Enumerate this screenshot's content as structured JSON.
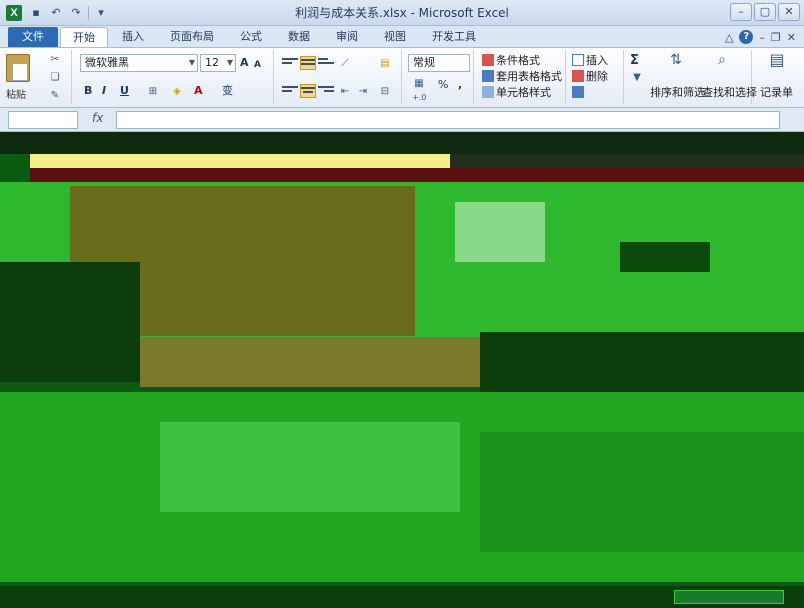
{
  "window": {
    "title": "利润与成本关系.xlsx - Microsoft Excel",
    "app_letter": "X"
  },
  "tabs": [
    {
      "label": "文件"
    },
    {
      "label": "开始"
    },
    {
      "label": "插入"
    },
    {
      "label": "页面布局"
    },
    {
      "label": "公式"
    },
    {
      "label": "数据"
    },
    {
      "label": "审阅"
    },
    {
      "label": "视图"
    },
    {
      "label": "开发工具"
    }
  ],
  "ribbon": {
    "clipboard": {
      "paste_label": "粘贴"
    },
    "font": {
      "name": "微软雅黑",
      "size": "12",
      "bold": "B",
      "italic": "I",
      "underline": "U",
      "grow": "A",
      "shrink": "A",
      "color_letter": "A",
      "phonetic": "变"
    },
    "number": {
      "format": "常规",
      "percent": "%",
      "comma": ","
    },
    "styles": {
      "conditional": "条件格式",
      "table": "套用表格格式",
      "cell": "单元格样式"
    },
    "cells": {
      "insert": "插入",
      "delete": "删除"
    },
    "editing": {
      "sigma": "Σ",
      "sort": "排序和筛选",
      "find": "查找和选择"
    },
    "record": {
      "label": "记录单"
    }
  },
  "colors": {
    "accent": "#2a6ab3",
    "sheet_green": "#0b5c12",
    "bright_green": "#2db82d",
    "yellow": "#f5ef8a",
    "olive": "#6b6b1c",
    "dark_red": "#5a0e0e"
  }
}
